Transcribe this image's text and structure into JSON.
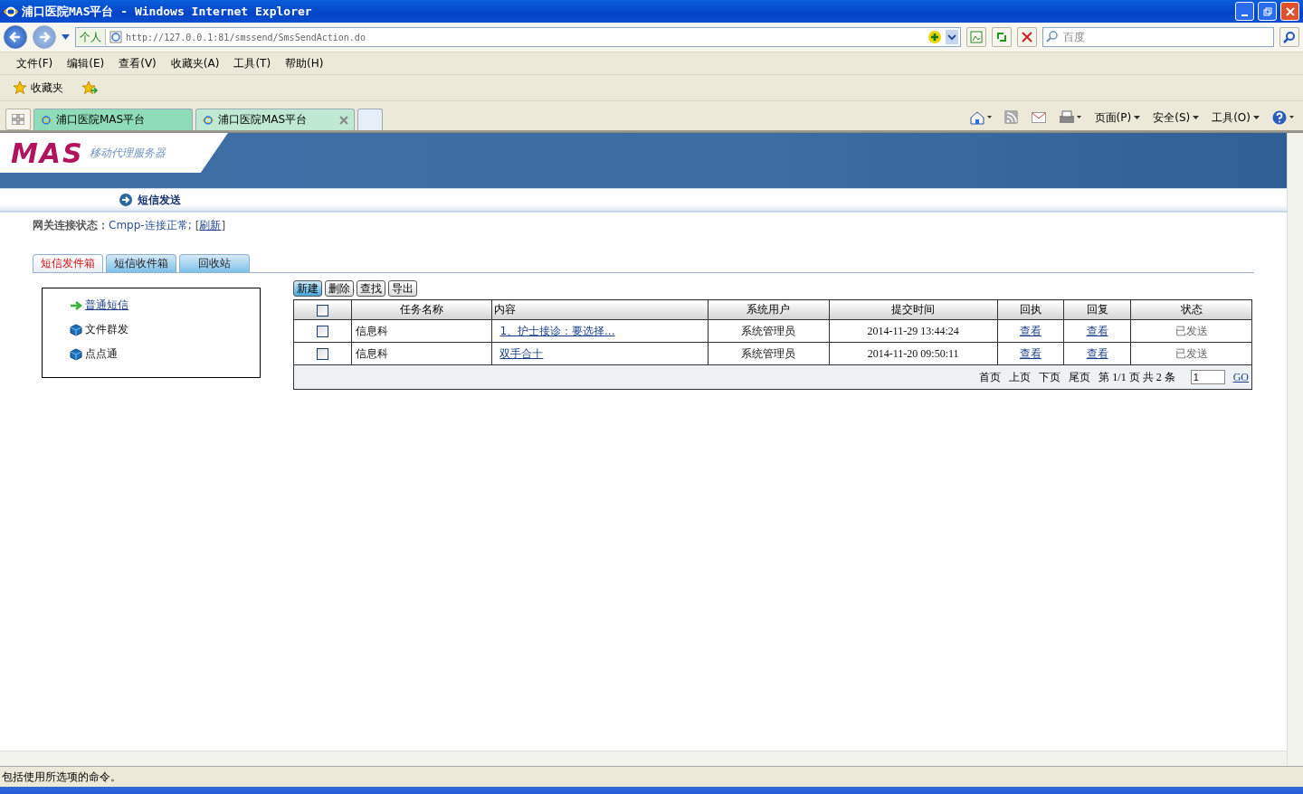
{
  "window": {
    "title": "浦口医院MAS平台 - Windows Internet Explorer"
  },
  "address": {
    "profile": "个人",
    "url": "http://127.0.0.1:81/smssend/SmsSendAction.do"
  },
  "search": {
    "placeholder": "百度"
  },
  "menu": [
    "文件(F)",
    "编辑(E)",
    "查看(V)",
    "收藏夹(A)",
    "工具(T)",
    "帮助(H)"
  ],
  "favorites": {
    "label": "收藏夹"
  },
  "browser_tabs": [
    {
      "label": "浦口医院MAS平台",
      "selected": false
    },
    {
      "label": "浦口医院MAS平台",
      "selected": true
    }
  ],
  "command_bar": [
    "页面(P)",
    "安全(S)",
    "工具(O)"
  ],
  "page": {
    "logo": "MAS",
    "logo_subtitle": "移动代理服务器",
    "heading": "短信发送",
    "gateway": {
      "label": "网关连接状态：",
      "value": "Cmpp-连接正常;",
      "open": "[",
      "link": "刷新",
      "close": "]"
    },
    "tabs": [
      {
        "label": "短信发件箱",
        "selected": true
      },
      {
        "label": "短信收件箱",
        "selected": false
      },
      {
        "label": "回收站",
        "selected": false
      }
    ],
    "side_menu": [
      {
        "label": "普通短信",
        "kind": "arrow",
        "selected": true
      },
      {
        "label": "文件群发",
        "kind": "cube",
        "selected": false
      },
      {
        "label": "点点通",
        "kind": "cube",
        "selected": false
      }
    ],
    "actions": [
      {
        "label": "新建",
        "selected": true
      },
      {
        "label": "删除",
        "selected": false
      },
      {
        "label": "查找",
        "selected": false
      },
      {
        "label": "导出",
        "selected": false
      }
    ],
    "table": {
      "header_checked": false,
      "columns": [
        "任务名称",
        "内容",
        "系统用户",
        "提交时间",
        "回执",
        "回复",
        "状态"
      ],
      "rows": [
        {
          "checked": false,
          "task": "信息科",
          "content": "1、护士接诊：要选择...",
          "user": "系统管理员",
          "time": "2014-11-29 13:44:24",
          "receipt": "查看",
          "reply": "查看",
          "status": "已发送"
        },
        {
          "checked": false,
          "task": "信息科",
          "content": "双手合十",
          "user": "系统管理员",
          "time": "2014-11-20 09:50:11",
          "receipt": "查看",
          "reply": "查看",
          "status": "已发送"
        }
      ]
    },
    "pager": {
      "links": [
        "首页",
        "上页",
        "下页",
        "尾页"
      ],
      "summary": "第 1/1 页 共 2 条",
      "page_input": "1",
      "go": "GO"
    }
  },
  "status_bar": {
    "text": "包括使用所选项的命令。"
  }
}
